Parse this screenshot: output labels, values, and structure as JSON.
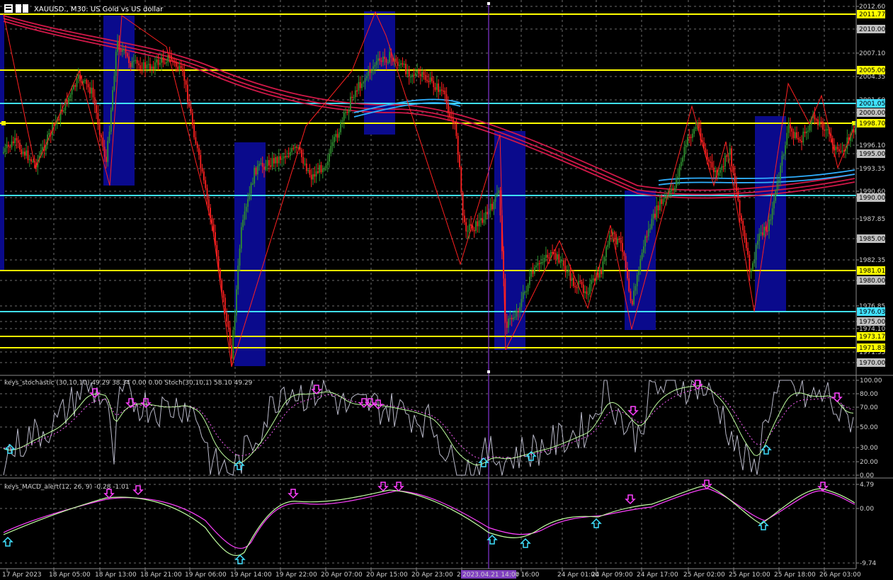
{
  "window": {
    "symbol_title": "XAUUSD., M30:  US Gold vs US dollar"
  },
  "colors": {
    "background": "#000000",
    "grid": "#8a8a8a",
    "bull_candle": "#2f8f2f",
    "bear_candle": "#ff2020",
    "zone": "#0a0a8c",
    "yellow_level": "#ffff00",
    "cyan_level": "#40e0ff",
    "ma_red": "#d01848",
    "ma_cyan": "#30b0ff",
    "zigzag": "#ff2020",
    "stoch_main": "#b8b8c8",
    "stoch_signal": "#c0ffa0",
    "stoch_dotted": "#ff60ff",
    "macd_line": "#c0ffa0",
    "macd_signal": "#ff40ff",
    "arrow_up": "#40e0ff",
    "arrow_down": "#ff40ff",
    "vline": "#a040ff"
  },
  "price_axis": {
    "ticks": [
      "2012.60",
      "2010.00",
      "2007.10",
      "2004.35",
      "2001.60",
      "2000.00",
      "1996.10",
      "1995.00",
      "1993.35",
      "1990.60",
      "1990.00",
      "1987.85",
      "1985.00",
      "1982.35",
      "1980.00",
      "1976.85",
      "1975.00",
      "1974.10",
      "1971.35",
      "1970.00"
    ],
    "highlighted_labels": [
      {
        "text": "2011.77",
        "kind": "yellow"
      },
      {
        "text": "2005.00",
        "kind": "yellow"
      },
      {
        "text": "2001.05",
        "kind": "cyan"
      },
      {
        "text": "1998.70",
        "kind": "yellow"
      },
      {
        "text": "1981.01",
        "kind": "yellow"
      },
      {
        "text": "1976.03",
        "kind": "cyan"
      },
      {
        "text": "1973.17",
        "kind": "yellow"
      },
      {
        "text": "1971.83",
        "kind": "yellow"
      }
    ]
  },
  "stochastic": {
    "label": "keys_stochastic (30,10,10) 49.29 38.34 0.00 0.00 Stoch(30,10,1) 58.10 49.29",
    "ticks": [
      "100.00",
      "80.00",
      "70.00",
      "50.00",
      "30.00",
      "20.00",
      "0.00"
    ]
  },
  "macd": {
    "label": "keys_MACD_alert(12, 26, 9) -0.28 -1.01",
    "ticks": [
      "4.79",
      "0.00",
      "-9.74"
    ]
  },
  "time_axis": {
    "labels": [
      "17 Apr 2023",
      "18 Apr 05:00",
      "18 Apr 13:00",
      "18 Apr 21:00",
      "19 Apr 06:00",
      "19 Apr 14:00",
      "19 Apr 22:00",
      "20 Apr 07:00",
      "20 Apr 15:00",
      "20 Apr 23:00",
      "21 A",
      "r 16:00",
      "24 Apr 01:00",
      "24 Apr 09:00",
      "24 Apr 17:00",
      "25 Apr 02:00",
      "25 Apr 10:00",
      "25 Apr 18:00",
      "26 Apr 03:00"
    ],
    "cursor_label": "2023.04.21 14:00"
  }
}
